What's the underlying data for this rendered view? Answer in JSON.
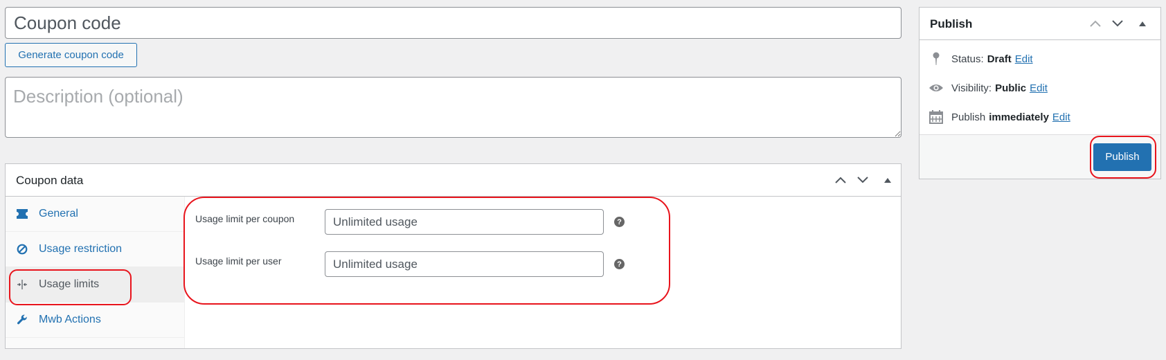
{
  "coupon": {
    "title_placeholder": "Coupon code",
    "generate_label": "Generate coupon code",
    "description_placeholder": "Description (optional)"
  },
  "coupon_data": {
    "title": "Coupon data",
    "tabs": [
      {
        "label": "General",
        "icon": "ticket-icon"
      },
      {
        "label": "Usage restriction",
        "icon": "restriction-icon"
      },
      {
        "label": "Usage limits",
        "icon": "usage-limits-icon",
        "active": true
      },
      {
        "label": "Mwb Actions",
        "icon": "wrench-icon"
      }
    ],
    "fields": [
      {
        "label": "Usage limit per coupon",
        "placeholder": "Unlimited usage"
      },
      {
        "label": "Usage limit per user",
        "placeholder": "Unlimited usage"
      }
    ]
  },
  "publish": {
    "title": "Publish",
    "status_label": "Status:",
    "status_value": "Draft",
    "visibility_label": "Visibility:",
    "visibility_value": "Public",
    "schedule_label": "Publish",
    "schedule_value": "immediately",
    "edit_label": "Edit",
    "button_label": "Publish"
  },
  "colors": {
    "accent": "#2271b1",
    "annotation": "#e8141c"
  }
}
